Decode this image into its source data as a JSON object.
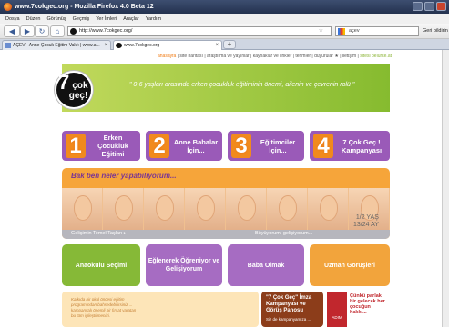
{
  "window": {
    "title": "www.7cokgec.org - Mozilla Firefox 4.0 Beta 12"
  },
  "menu": [
    "Dosya",
    "Düzen",
    "Görünüş",
    "Geçmiş",
    "Yer İmleri",
    "Araçlar",
    "Yardım"
  ],
  "nav": {
    "url": "http://www.7cokgec.org/",
    "search_placeholder": "açev",
    "back_label": "Geri bildirin"
  },
  "tabs": [
    {
      "label": "AÇEV - Anne Çocuk Eğitim Vakfı | www.a..."
    },
    {
      "label": "www.7cokgec.org"
    }
  ],
  "page": {
    "toplinks": {
      "first": "anasayfa",
      "middle": " | site haritası | araştırma ve yayınlar | kaynaklar ve linkler | terimler | duyurular ★ | iletişim | ",
      "last": "sitesi belurke.at"
    },
    "slogan": "\" 0-6 yaşları arasında erken çocukluk eğitiminin önemi, ailenin ve çevrenin rolü \"",
    "logo": {
      "number": "7",
      "line1": "çok",
      "line2": "geç!"
    },
    "main_buttons": [
      {
        "num": "1",
        "label": "Erken Çocukluk Eğitimi",
        "color": "#9e5fb9"
      },
      {
        "num": "2",
        "label": "Anne Babalar İçin...",
        "color": "#a05bb3"
      },
      {
        "num": "3",
        "label": "Eğitimciler İçin...",
        "color": "#9b58b5"
      },
      {
        "num": "4",
        "label": "7 Çok Geç ! Kampanyası",
        "color": "#9b58b5"
      }
    ],
    "banner": {
      "title": "Bak ben neler yapabiliyorum...",
      "left_caption": "Gelişimin Temel Taşları ▸",
      "right_caption": "Büyüyorum, gelişiyorum...",
      "age": "1/2 YAŞ\n13/24 AY"
    },
    "tiles": [
      {
        "label": "Anaokulu Seçimi",
        "color": "#86b937"
      },
      {
        "label": "Eğlenerek Öğreniyor ve Gelişiyorum",
        "color": "#a66cc2"
      },
      {
        "label": "Baba Olmak",
        "color": "#a66cc2"
      },
      {
        "label": "Uzman Görüşleri",
        "color": "#f2a43c"
      }
    ],
    "bottom": {
      "left_text": "Katkıda bir okul öncesi eğitim\nprogramından bahsedebilirsiniz ...\nkampanyalı önemli bir fırsat yaratan\nbu tüm iyileştirmenizi.",
      "mid_text": "\"7 Çok Geç\" İmza Kampanyası ve Görüş Panosu",
      "mid_sub": "Siz de kampanyamıza ...",
      "right_text": "Çünkü parlak bir gelecek her çocuğun hakkı...",
      "adim": "ADIM"
    }
  }
}
